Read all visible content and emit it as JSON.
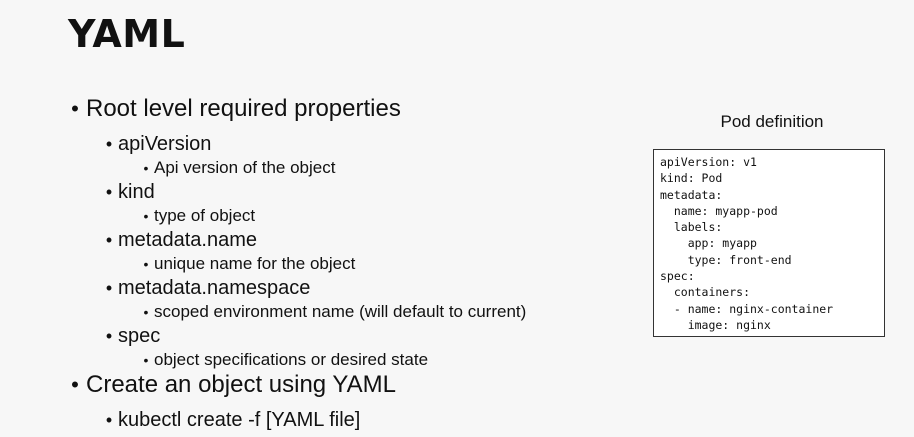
{
  "title": "YAML",
  "bullets": {
    "root": "Root level required properties",
    "api_version": "apiVersion",
    "api_version_desc": "Api version of the object",
    "kind": "kind",
    "kind_desc": "type of object",
    "metadata_name": "metadata.name",
    "metadata_name_desc": "unique name for the object",
    "metadata_namespace": "metadata.namespace",
    "metadata_namespace_desc": "scoped environment name (will default to current)",
    "spec": "spec",
    "spec_desc": "object specifications or desired state",
    "create": "Create an object using YAML",
    "create_cmd": "kubectl create -f [YAML file]"
  },
  "bullet_symbol": "•",
  "pod": {
    "caption": "Pod definition",
    "lines": [
      "apiVersion: v1",
      "kind: Pod",
      "metadata:",
      "  name: myapp-pod",
      "  labels:",
      "    app: myapp",
      "    type: front-end",
      "spec:",
      "  containers:",
      "  - name: nginx-container",
      "    image: nginx"
    ]
  }
}
